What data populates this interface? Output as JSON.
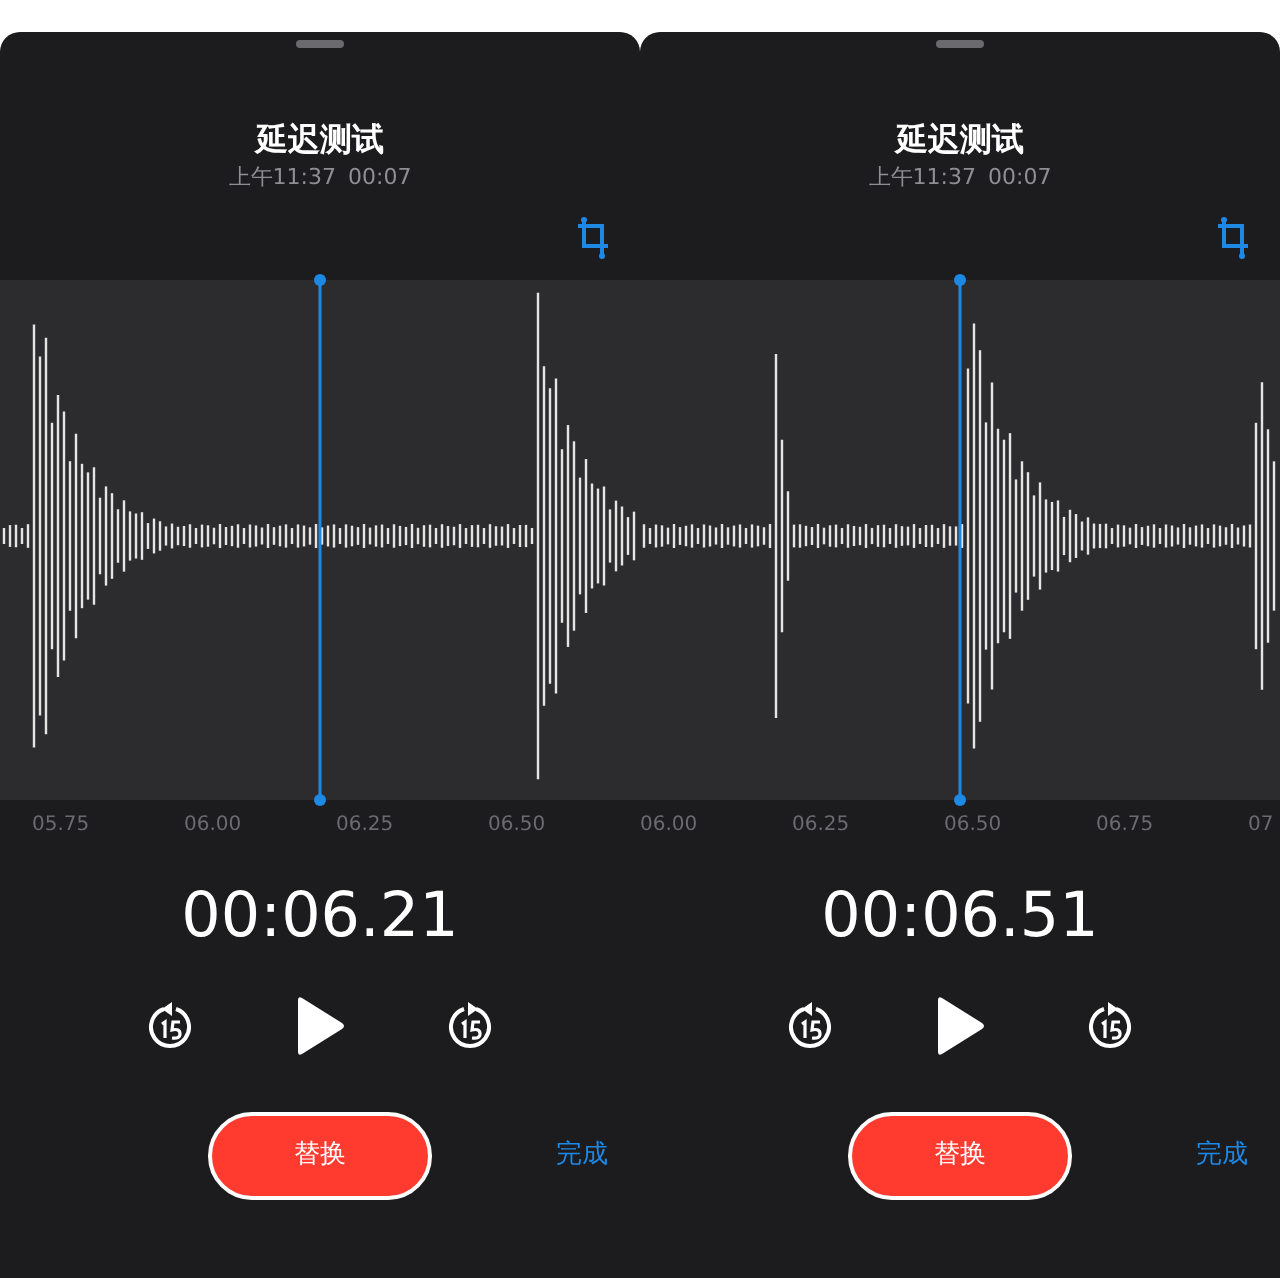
{
  "panels": [
    {
      "title": "延迟测试",
      "date": "上午11:37",
      "duration": "00:07",
      "ticks": [
        "05.75",
        "06.00",
        "06.25",
        "06.50"
      ],
      "time": "00:06.21",
      "replace_button": "替换",
      "done_button": "完成"
    },
    {
      "title": "延迟测试",
      "date": "上午11:37",
      "duration": "00:07",
      "ticks": [
        "06.00",
        "06.25",
        "06.50",
        "06.75",
        "07"
      ],
      "time": "00:06.51",
      "replace_button": "替换",
      "done_button": "完成"
    }
  ]
}
